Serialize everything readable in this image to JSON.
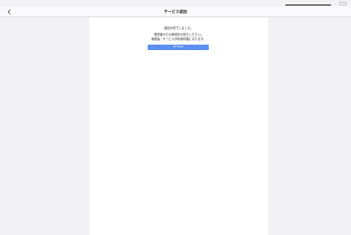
{
  "navbar": {
    "title": "サービス追加"
  },
  "main": {
    "line1": "追加が完了しました。",
    "line2": "運営者からの承認をお待ちください。",
    "line3": "承認後、サービスが利用可能になります。",
    "button_label": "MY PAGE"
  },
  "icons": {
    "back": "chevron-left-icon"
  },
  "colors": {
    "button": "#5b8ff2",
    "background": "#f2f2f4",
    "card": "#ffffff"
  }
}
